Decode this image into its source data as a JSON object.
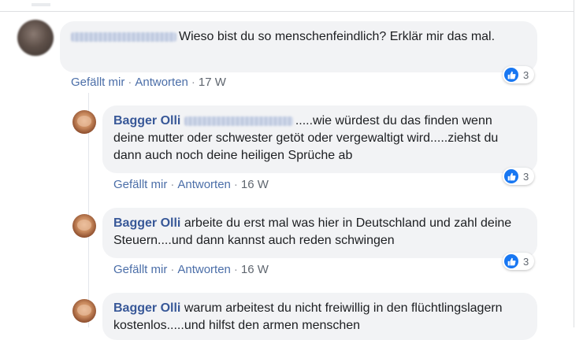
{
  "comments": [
    {
      "author": "",
      "text": "Wieso bist du so menschenfeindlich? Erklär mir das mal.",
      "like_label": "Gefällt mir",
      "reply_label": "Antworten",
      "time": "17 W",
      "reactions": "3"
    },
    {
      "author": "Bagger Olli",
      "text": ".....wie würdest du das finden wenn deine mutter oder schwester getöt oder vergewaltigt wird.....ziehst du dann auch noch deine heiligen Sprüche ab",
      "like_label": "Gefällt mir",
      "reply_label": "Antworten",
      "time": "16 W",
      "reactions": "3"
    },
    {
      "author": "Bagger Olli",
      "text": "arbeite du erst mal was hier in Deutschland und zahl deine Steuern....und dann kannst auch reden schwingen",
      "like_label": "Gefällt mir",
      "reply_label": "Antworten",
      "time": "16 W",
      "reactions": "3"
    },
    {
      "author": "Bagger Olli",
      "text": "warum arbeitest du nicht freiwillig in den flüchtlingslagern kostenlos.....und hilfst den armen menschen"
    }
  ],
  "colors": {
    "link": "#385898",
    "bubble": "#f2f3f5",
    "like": "#1877f2"
  },
  "icons": {
    "like": "thumbs-up-icon"
  }
}
